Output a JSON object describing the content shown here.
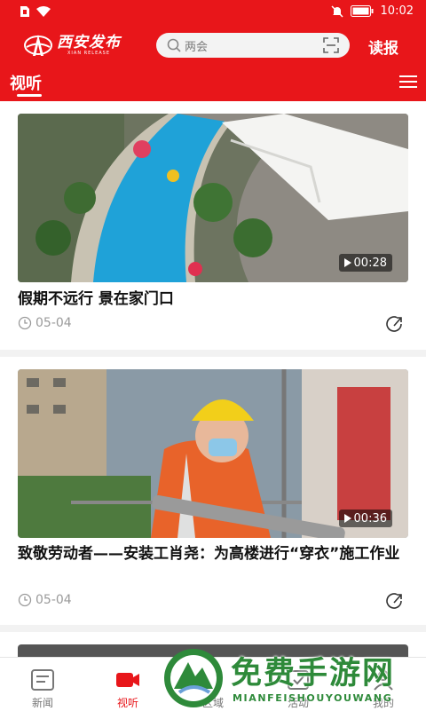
{
  "status_bar": {
    "time": "10:02",
    "battery_icon": "battery-icon",
    "signal_icon": "wifi-icon"
  },
  "header": {
    "logo_name": "西安发布",
    "logo_sub": "XIAN RELEASE",
    "search_placeholder": "两会",
    "read_paper": "读报",
    "brand_color": "#e8161a"
  },
  "tabs": {
    "active": "视听"
  },
  "feed": [
    {
      "title": "假期不远行  景在家门口",
      "duration": "00:28",
      "date": "05-04"
    },
    {
      "title": "致敬劳动者——安装工肖尧：为高楼进行“穿衣”施工作业",
      "duration": "00:36",
      "date": "05-04"
    }
  ],
  "bottom_nav": [
    {
      "label": "新闻",
      "icon": "news-icon"
    },
    {
      "label": "视听",
      "icon": "video-icon"
    },
    {
      "label": "区域",
      "icon": "region-icon"
    },
    {
      "label": "活动",
      "icon": "activity-icon"
    },
    {
      "label": "我的",
      "icon": "profile-icon"
    }
  ],
  "watermark": {
    "title": "免费手游网",
    "sub": "MIANFEISHOUYOUWANG"
  }
}
